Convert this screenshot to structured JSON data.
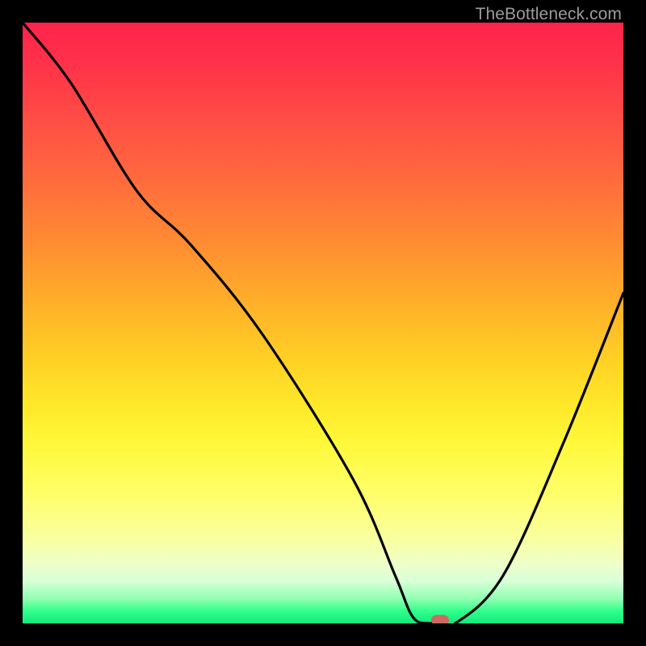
{
  "watermark": "TheBottleneck.com",
  "chart_data": {
    "type": "line",
    "title": "",
    "xlabel": "",
    "ylabel": "",
    "x_range_percent": [
      0,
      100
    ],
    "y_range_percent": [
      0,
      100
    ],
    "series": [
      {
        "name": "bottleneck-curve",
        "x_percent": [
          0,
          8,
          19,
          28,
          40,
          55,
          62,
          65,
          68,
          72,
          80,
          90,
          100
        ],
        "y_percent": [
          100,
          90,
          72,
          63,
          48,
          24,
          8,
          1,
          0,
          0,
          8,
          30,
          55
        ]
      }
    ],
    "marker": {
      "x_percent": 69.5,
      "y_percent": 0.5,
      "color": "#c96a63"
    },
    "gradient_stops_percent_from_top": {
      "0": "#ff234b",
      "6": "#ff2f4a",
      "16": "#ff4d45",
      "26": "#ff6a3d",
      "36": "#ff8a33",
      "46": "#ffad2a",
      "56": "#ffd024",
      "64": "#ffe92a",
      "70": "#fff83a",
      "78": "#ffff66",
      "86": "#f9ffa0",
      "90": "#eeffc8",
      "93": "#d8ffd8",
      "96": "#8dffb0",
      "98": "#2eff8a",
      "100": "#14e77c"
    }
  }
}
